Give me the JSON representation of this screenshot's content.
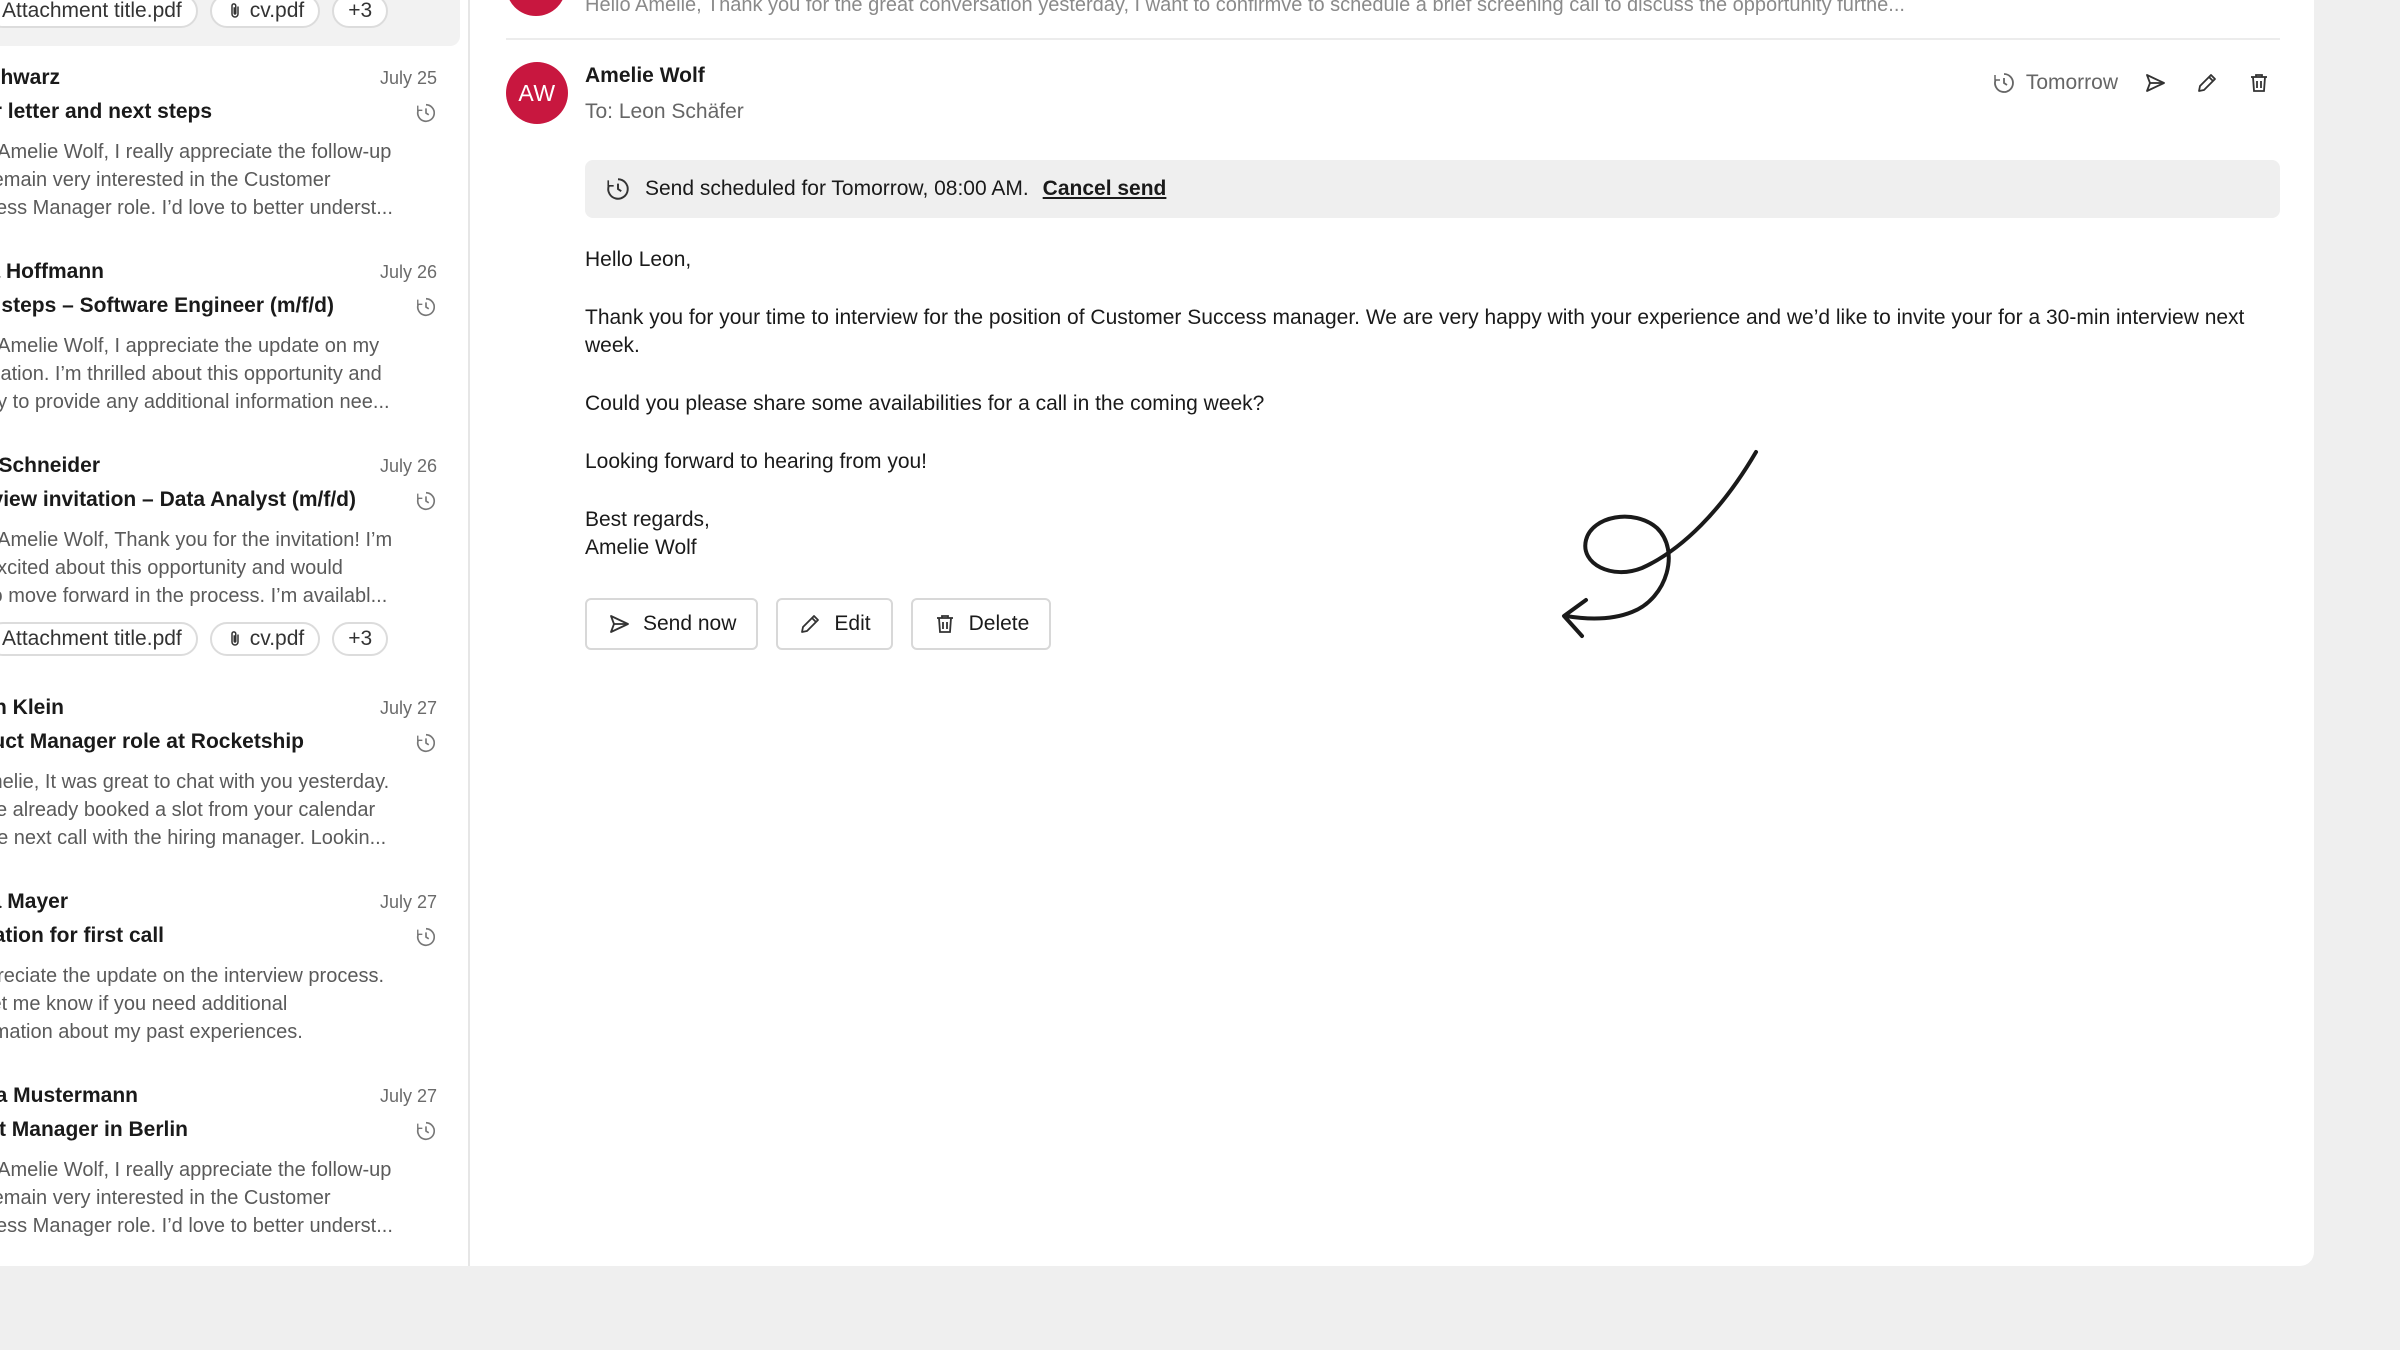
{
  "list": {
    "top_chips": [
      "Attachment title.pdf",
      "cv.pdf",
      "+3"
    ],
    "items": [
      {
        "sender": "Schwarz",
        "date": "July 25",
        "subject": "r letter and next steps",
        "preview": [
          "r Amelie Wolf, I really appreciate the follow-up",
          "remain very interested in the Customer",
          "cess Manager role. I’d love to better underst..."
        ]
      },
      {
        "sender": "a Hoffmann",
        "date": "July 26",
        "subject": "t steps – Software Engineer (m/f/d)",
        "preview": [
          "r Amelie Wolf, I appreciate the update on my",
          "ication. I’m thrilled about this opportunity and",
          "py to provide any additional information nee..."
        ]
      },
      {
        "sender": "Schneider",
        "date": "July 26",
        "subject": "rview invitation – Data Analyst (m/f/d)",
        "preview": [
          "r Amelie Wolf, Thank you for the invitation! I’m",
          " excited about this opportunity and would",
          " to move forward in the process. I’m availabl..."
        ],
        "chips": [
          "Attachment title.pdf",
          "cv.pdf",
          "+3"
        ]
      },
      {
        "sender": "an Klein",
        "date": "July 27",
        "subject": "luct Manager role at Rocketship",
        "preview": [
          "melie, It was great to chat with you yesterday.",
          "ve already booked a slot from your calendar",
          "he next call with the hiring manager. Lookin..."
        ]
      },
      {
        "sender": "a Mayer",
        "date": "July 27",
        "subject": "ation for first call",
        "preview": [
          "preciate the update on the interview process.",
          " let me know if you need additional",
          "rmation about my past experiences."
        ]
      },
      {
        "sender": "a Mustermann",
        "date": "July 27",
        "subject": "ct Manager in Berlin",
        "preview": [
          "r Amelie Wolf, I really appreciate the follow-up",
          "remain very interested in the Customer",
          "cess Manager role. I’d love to better underst..."
        ]
      }
    ]
  },
  "thread": {
    "previous_preview": "Hello Amelie, Thank you for the great conversation yesterday, I want to confirmve to schedule a brief screening call to discuss the opportunity furthe..."
  },
  "message": {
    "avatar_initials": "AW",
    "avatar_color": "#c8173f",
    "from": "Amelie Wolf",
    "to": "To: Leon Schäfer",
    "scheduled_when": "Tomorrow",
    "banner_text": "Send scheduled for Tomorrow, 08:00 AM.",
    "banner_link": "Cancel send",
    "body": {
      "greeting": "Hello Leon,",
      "p1": "Thank you for your time to interview for the position of Customer Success manager. We are very happy with your experience and we’d like to invite your for a 30-min interview next week.",
      "p2": "Could you please share some availabilities for a call in the coming week?",
      "p3": "Looking forward to hearing from you!",
      "closing": "Best regards,",
      "signature": "Amelie Wolf"
    },
    "buttons": {
      "send_now": "Send now",
      "edit": "Edit",
      "delete": "Delete"
    }
  }
}
